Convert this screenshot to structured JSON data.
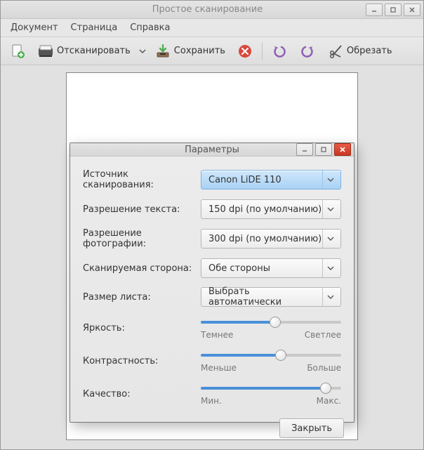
{
  "window": {
    "title": "Простое сканирование"
  },
  "menubar": {
    "items": [
      "Документ",
      "Страница",
      "Справка"
    ]
  },
  "toolbar": {
    "scan_label": "Отсканировать",
    "save_label": "Сохранить",
    "crop_label": "Обрезать"
  },
  "dialog": {
    "title": "Параметры",
    "labels": {
      "source": "Источник сканирования:",
      "text_res": "Разрешение текста:",
      "photo_res": "Разрешение фотографии:",
      "side": "Сканируемая сторона:",
      "page_size": "Размер листа:",
      "brightness": "Яркость:",
      "contrast": "Контрастность:",
      "quality": "Качество:"
    },
    "values": {
      "source": "Canon LiDE 110",
      "text_res": "150 dpi (по умолчанию)",
      "photo_res": "300 dpi (по умолчанию)",
      "side": "Обе стороны",
      "page_size": "Выбрать автоматически"
    },
    "sliders": {
      "brightness": {
        "min_label": "Темнее",
        "max_label": "Светлее",
        "value": 53
      },
      "contrast": {
        "min_label": "Меньше",
        "max_label": "Больше",
        "value": 57
      },
      "quality": {
        "min_label": "Мин.",
        "max_label": "Макс.",
        "value": 89
      }
    },
    "close_button": "Закрыть"
  }
}
